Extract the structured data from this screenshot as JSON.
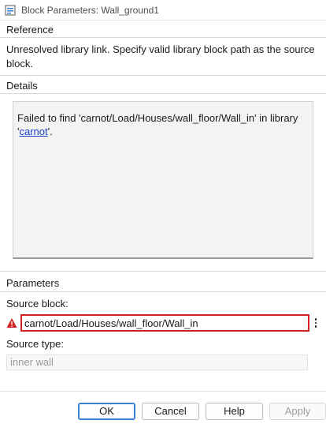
{
  "window": {
    "title": "Block Parameters: Wall_ground1",
    "icon": "block-params-icon"
  },
  "reference": {
    "header": "Reference",
    "text": "Unresolved library link. Specify valid library block path as the source block."
  },
  "details": {
    "header": "Details",
    "text_before": "Failed to find 'carnot/Load/Houses/wall_floor/Wall_in' in library '",
    "link": "carnot",
    "text_after": "'."
  },
  "parameters": {
    "header": "Parameters",
    "source_block_label": "Source block:",
    "source_block_value": "carnot/Load/Houses/wall_floor/Wall_in",
    "source_type_label": "Source type:",
    "source_type_value": "inner wall",
    "warning_icon": "warning-icon",
    "error_color": "#d02020"
  },
  "buttons": {
    "ok": "OK",
    "cancel": "Cancel",
    "help": "Help",
    "apply": "Apply"
  }
}
